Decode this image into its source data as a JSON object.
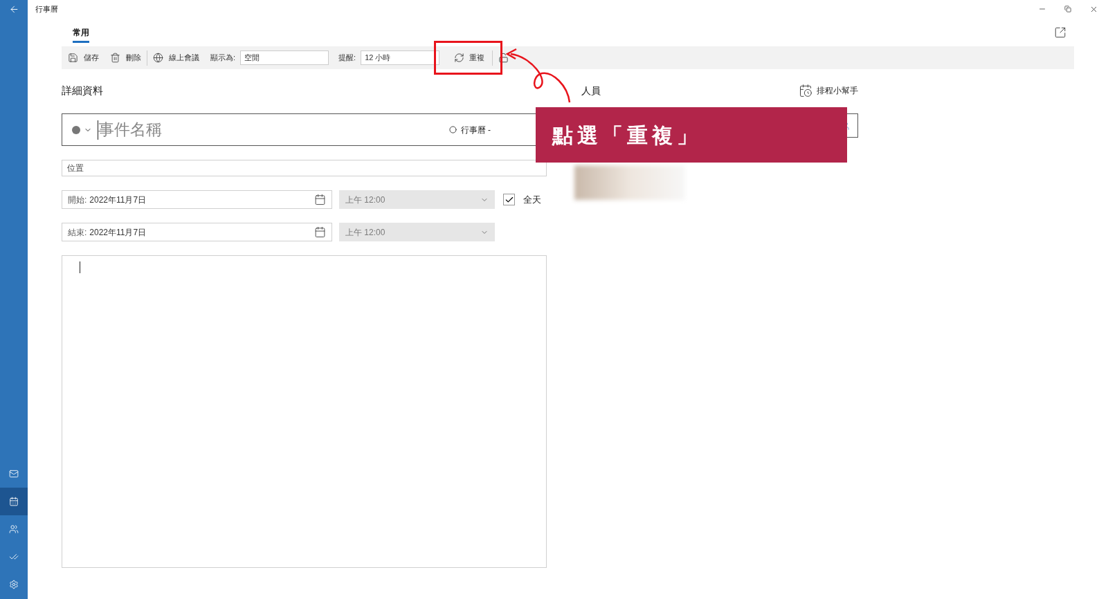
{
  "window": {
    "title": "行事曆"
  },
  "tabs": [
    {
      "label": "常用",
      "selected": true
    }
  ],
  "toolbar": {
    "save": "儲存",
    "delete": "刪除",
    "online_meeting": "線上會議",
    "show_as": {
      "label": "顯示為:",
      "value": "空閒"
    },
    "reminder": {
      "label": "提醒:",
      "value": "12 小時"
    },
    "repeat": "重複"
  },
  "details": {
    "heading": "詳細資料",
    "event_name": {
      "placeholder": "事件名稱"
    },
    "calendar": "行事曆 -",
    "location": {
      "placeholder": "位置"
    },
    "start": {
      "label": "開始:",
      "date": "2022年11月7日",
      "time": "上午 12:00",
      "disabled": true
    },
    "end": {
      "label": "結束:",
      "date": "2022年11月7日",
      "time": "上午 12:00",
      "disabled": true
    },
    "all_day": {
      "label": "全天",
      "checked": true
    }
  },
  "people": {
    "heading": "人員",
    "scheduling_assistant": "排程小幫手"
  },
  "annotation": {
    "text": "點選「重複」"
  },
  "nav": [
    {
      "kind": "mail",
      "selected": false
    },
    {
      "kind": "calendar",
      "selected": true
    },
    {
      "kind": "people",
      "selected": false
    },
    {
      "kind": "todo",
      "selected": false
    },
    {
      "kind": "settings",
      "selected": false
    }
  ]
}
